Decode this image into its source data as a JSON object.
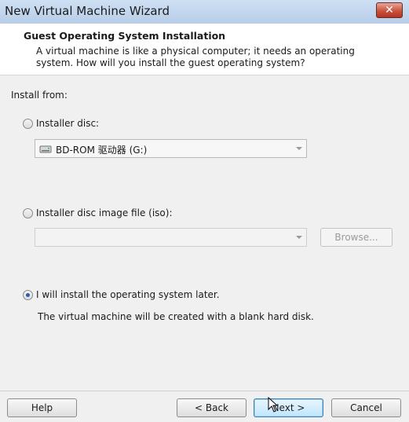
{
  "window": {
    "title": "New Virtual Machine Wizard",
    "close_label": "✕"
  },
  "header": {
    "title": "Guest Operating System Installation",
    "description": "A virtual machine is like a physical computer; it needs an operating system. How will you install the guest operating system?"
  },
  "install_from": {
    "label": "Install from:",
    "options": [
      {
        "label": "Installer disc:",
        "selected": false
      },
      {
        "label": "Installer disc image file (iso):",
        "selected": false
      },
      {
        "label": "I will install the operating system later.",
        "selected": true
      }
    ],
    "disc_drive": {
      "value": "BD-ROM 驱动器 (G:)",
      "icon": "disc-drive-icon"
    },
    "iso_path": {
      "value": ""
    },
    "browse_label": "Browse...",
    "later_note": "The virtual machine will be created with a blank hard disk."
  },
  "footer": {
    "help_label": "Help",
    "back_label": "< Back",
    "next_label": "Next >",
    "cancel_label": "Cancel"
  }
}
